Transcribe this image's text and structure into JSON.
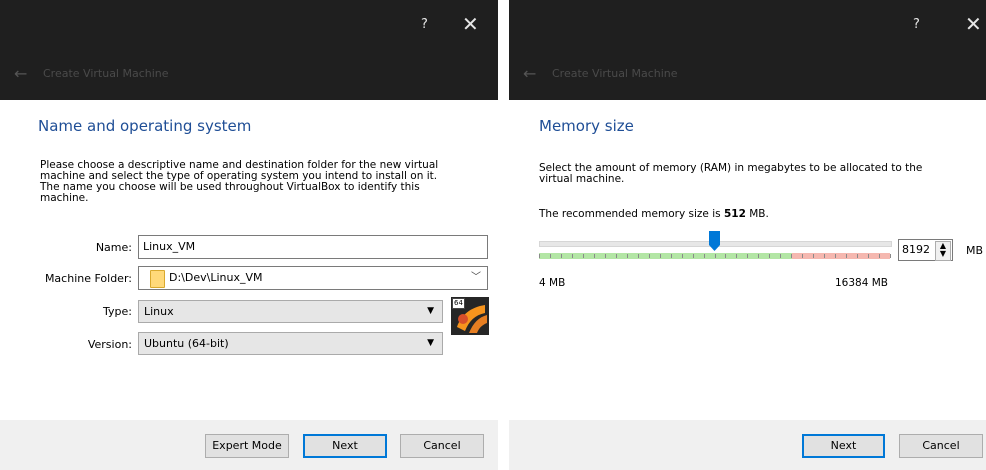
{
  "dialog1": {
    "window": {
      "help": "?",
      "close": "✕",
      "title": "Create Virtual Machine"
    },
    "heading": "Name and operating system",
    "description": [
      "Please choose a descriptive name and destination folder for the new virtual",
      "machine and select the type of operating system you intend to install on it.",
      "The name you choose will be used throughout VirtualBox to identify this",
      "machine."
    ],
    "name_label": "Name:",
    "name_value": "Linux_VM",
    "folder_label": "Machine Folder:",
    "folder_value": "D:\\Dev\\Linux_VM",
    "type_label": "Type:",
    "type_value": "Linux",
    "version_label": "Version:",
    "version_value": "Ubuntu (64-bit)",
    "os_badge": "64",
    "buttons": {
      "expert": "Expert Mode",
      "next": "Next",
      "cancel": "Cancel"
    }
  },
  "dialog2": {
    "window": {
      "help": "?",
      "close": "✕",
      "title": "Create Virtual Machine"
    },
    "heading": "Memory size",
    "description": [
      "Select the amount of memory (RAM) in megabytes to be allocated to the",
      "virtual machine."
    ],
    "recommended_prefix": "The recommended memory size is ",
    "recommended_value": "512",
    "recommended_suffix": " MB.",
    "memory_value": "8192",
    "memory_unit": "MB",
    "slider_min_label": "4 MB",
    "slider_max_label": "16384 MB",
    "slider_min": 4,
    "slider_max": 16384,
    "slider_value": 8192,
    "buttons": {
      "next": "Next",
      "cancel": "Cancel"
    }
  },
  "colors": {
    "titlebar": "#1f1f1f",
    "heading": "#1f4e96",
    "accent": "#0078d7",
    "slider_green": "#b3e6a5",
    "slider_red": "#f5b8b0"
  }
}
